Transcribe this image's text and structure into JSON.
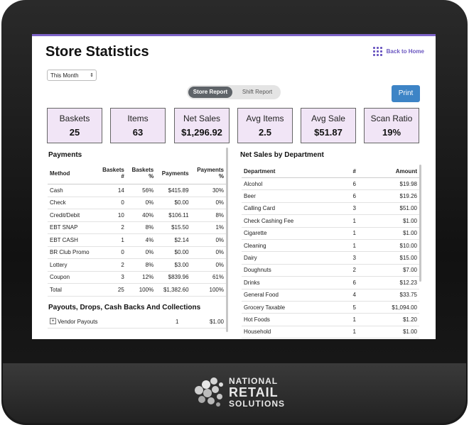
{
  "page": {
    "title": "Store Statistics",
    "back_label": "Back to Home"
  },
  "filters": {
    "period": "This Month"
  },
  "report_toggle": {
    "active": "Store Report",
    "inactive": "Shift Report"
  },
  "print_label": "Print",
  "kpis": [
    {
      "label": "Baskets",
      "value": "25"
    },
    {
      "label": "Items",
      "value": "63"
    },
    {
      "label": "Net Sales",
      "value": "$1,296.92"
    },
    {
      "label": "Avg Items",
      "value": "2.5"
    },
    {
      "label": "Avg Sale",
      "value": "$51.87"
    },
    {
      "label": "Scan Ratio",
      "value": "19%"
    }
  ],
  "payments": {
    "title": "Payments",
    "headers": {
      "method": "Method",
      "baskets_a": "Baskets",
      "baskets_b": "#",
      "pct_a": "Baskets",
      "pct_b": "%",
      "payments": "Payments",
      "ppct_a": "Payments",
      "ppct_b": "%"
    },
    "rows": [
      {
        "method": "Cash",
        "baskets": "14",
        "baskets_pct": "56%",
        "payments": "$415.89",
        "payments_pct": "30%"
      },
      {
        "method": "Check",
        "baskets": "0",
        "baskets_pct": "0%",
        "payments": "$0.00",
        "payments_pct": "0%"
      },
      {
        "method": "Credit/Debit",
        "baskets": "10",
        "baskets_pct": "40%",
        "payments": "$106.11",
        "payments_pct": "8%"
      },
      {
        "method": "EBT SNAP",
        "baskets": "2",
        "baskets_pct": "8%",
        "payments": "$15.50",
        "payments_pct": "1%"
      },
      {
        "method": "EBT CASH",
        "baskets": "1",
        "baskets_pct": "4%",
        "payments": "$2.14",
        "payments_pct": "0%"
      },
      {
        "method": "BR Club Promo",
        "baskets": "0",
        "baskets_pct": "0%",
        "payments": "$0.00",
        "payments_pct": "0%"
      },
      {
        "method": "Lottery",
        "baskets": "2",
        "baskets_pct": "8%",
        "payments": "$3.00",
        "payments_pct": "0%"
      },
      {
        "method": "Coupon",
        "baskets": "3",
        "baskets_pct": "12%",
        "payments": "$839.96",
        "payments_pct": "61%"
      },
      {
        "method": "Total",
        "baskets": "25",
        "baskets_pct": "100%",
        "payments": "$1,382.60",
        "payments_pct": "100%"
      }
    ]
  },
  "payouts": {
    "title": "Payouts, Drops, Cash Backs And Collections",
    "rows": [
      {
        "label": "Vendor Payouts",
        "count": "1",
        "amount": "$1.00"
      }
    ]
  },
  "department": {
    "title": "Net Sales by Department",
    "headers": {
      "department": "Department",
      "count": "#",
      "amount": "Amount"
    },
    "rows": [
      {
        "name": "Alcohol",
        "count": "6",
        "amount": "$19.98"
      },
      {
        "name": "Beer",
        "count": "6",
        "amount": "$19.26"
      },
      {
        "name": "Calling Card",
        "count": "3",
        "amount": "$51.00"
      },
      {
        "name": "Check Cashing Fee",
        "count": "1",
        "amount": "$1.00"
      },
      {
        "name": "Cigarette",
        "count": "1",
        "amount": "$1.00"
      },
      {
        "name": "Cleaning",
        "count": "1",
        "amount": "$10.00"
      },
      {
        "name": "Dairy",
        "count": "3",
        "amount": "$15.00"
      },
      {
        "name": "Doughnuts",
        "count": "2",
        "amount": "$7.00"
      },
      {
        "name": "Drinks",
        "count": "6",
        "amount": "$12.23"
      },
      {
        "name": "General Food",
        "count": "4",
        "amount": "$33.75"
      },
      {
        "name": "Grocery Taxable",
        "count": "5",
        "amount": "$1,094.00"
      },
      {
        "name": "Hot Foods",
        "count": "1",
        "amount": "$1.20"
      },
      {
        "name": "Household",
        "count": "1",
        "amount": "$1.00"
      }
    ]
  },
  "brand": {
    "line1": "NATIONAL",
    "line2": "RETAIL",
    "line3": "SOLUTIONS"
  },
  "colors": {
    "accent": "#6a56c0",
    "kpi_bg": "#f1e5f6",
    "print_btn": "#3d84c6"
  }
}
